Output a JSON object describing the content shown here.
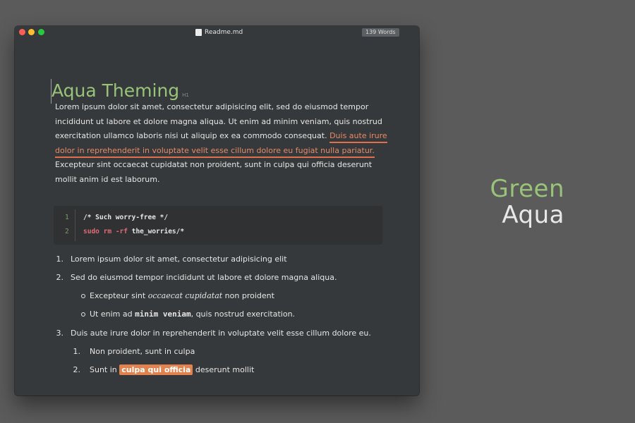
{
  "window": {
    "title": "Readme.md",
    "word_count": "139 Words"
  },
  "doc": {
    "heading": "Aqua Theming",
    "heading_tag": "H1",
    "para_1": "Lorem ipsum dolor sit amet, consectetur adipisicing elit, sed do eiusmod tempor incididunt ut labore et dolore magna aliqua. Ut enim ad minim veniam, quis nostrud exercitation ullamco laboris nisi ut aliquip ex ea commodo consequat.",
    "para_link": "Duis aute irure dolor in reprehenderit in voluptate velit esse cillum dolore eu fugiat nulla pariatur.",
    "para_2": "Excepteur sint occaecat cupidatat non proident, sunt in culpa qui officia deserunt mollit anim id est laborum."
  },
  "code": {
    "lines": [
      {
        "num": "1",
        "text": "/* Such worry-free */"
      },
      {
        "num": "2",
        "kw1": "sudo",
        "kw2": "rm",
        "kw3": "-rf",
        "rest": "the_worries/*"
      }
    ]
  },
  "list": {
    "item1": "Lorem ipsum dolor sit amet, consectetur adipisicing elit",
    "item2": "Sed do eiusmod tempor incididunt ut labore et dolore magna aliqua.",
    "item2_sub1_a": "Excepteur sint",
    "item2_sub1_ital": "occaecat cupidatat",
    "item2_sub1_b": "non proident",
    "item2_sub2_a": "Ut enim ad",
    "item2_sub2_mono": "minim veniam",
    "item2_sub2_b": ", quis nostrud exercitation.",
    "item3": "Duis aute irure dolor in reprehenderit in voluptate velit esse cillum dolore eu.",
    "item3_sub1": "Non proident, sunt in culpa",
    "item3_sub2_a": "Sunt in",
    "item3_sub2_hl": "culpa qui officia",
    "item3_sub2_b": "deserunt mollit",
    "nums": [
      "1.",
      "2.",
      "3.",
      "1.",
      "2."
    ]
  },
  "theme": {
    "line1": "Green",
    "line2": "Aqua"
  },
  "colors": {
    "background": "#5b5b5b",
    "editor_bg": "#36393b",
    "heading_green": "#98c379",
    "link_orange": "#e0704c",
    "highlight_orange": "#e2834f",
    "keyword_red": "#e06c75"
  },
  "icons": [
    "close-icon",
    "minimize-icon",
    "zoom-icon",
    "document-icon"
  ]
}
